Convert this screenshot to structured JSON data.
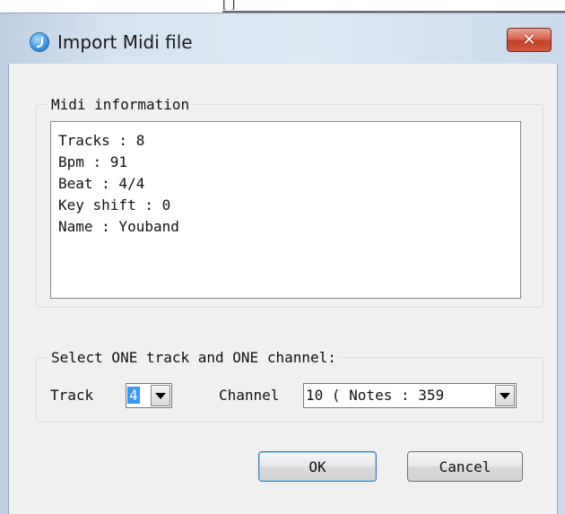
{
  "window": {
    "title": "Import Midi file",
    "close_label": "✕",
    "top_partial": "[ ]"
  },
  "midi_info": {
    "legend": "Midi information",
    "lines": [
      "Tracks : 8",
      "Bpm : 91",
      "Beat : 4/4",
      "Key shift : 0",
      "Name : Youband"
    ]
  },
  "selection": {
    "legend": "Select ONE track and ONE channel:",
    "track_label": "Track",
    "track_value": "4",
    "channel_label": "Channel",
    "channel_value": "10 ( Notes : 359"
  },
  "buttons": {
    "ok": "OK",
    "cancel": "Cancel"
  },
  "colors": {
    "frame": "#d6e3f1",
    "client": "#f0f0f0",
    "close_button": "#c43f28",
    "selection_highlight": "#3399ff"
  }
}
